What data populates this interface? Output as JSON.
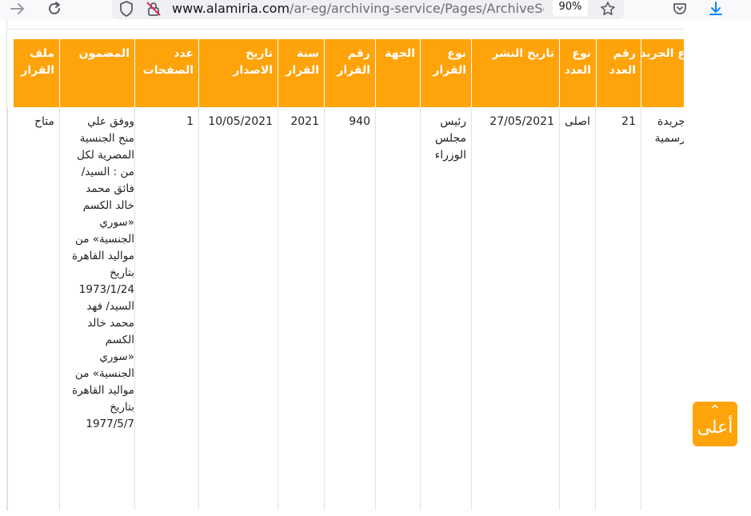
{
  "browser": {
    "url_host": "www.alamiria.com",
    "url_path": "/ar-eg/archiving-service/Pages/ArchiveSear",
    "zoom": "90%"
  },
  "table": {
    "headers": {
      "gazette_type": "نوع الجريدة",
      "issue_number": "رقم العدد",
      "issue_type": "نوع العدد",
      "publish_date": "تاريخ النشر",
      "decision_type": "نوع القرار",
      "authority": "الجهة",
      "decision_number": "رقم القرار",
      "decision_year": "سنة القرار",
      "issue_date": "تاريخ الاصدار",
      "page_count": "عدد الصفحات",
      "content": "المضمون",
      "decision_file": "ملف القرار"
    },
    "row": {
      "gazette_type": "جريدة رسمية",
      "issue_number": "21",
      "issue_type": "اصلى",
      "publish_date": "27/05/2021",
      "decision_type": "رئيس مجلس الوزراء",
      "authority": "",
      "decision_number": "940",
      "decision_year": "2021",
      "issue_date": "10/05/2021",
      "page_count": "1",
      "content": "ووفق علي منح الجنسية المصرية لكل من : السيد/ فائق محمد خالد الكسم «سوري الجنسية» من مواليد القاهرة بتاريخ 1973/1/24 السيد/ فهد محمد خالد الكسم «سوري الجنسية» من مواليد القاهرة بتاريخ 1977/5/7",
      "decision_file": "متاح"
    }
  },
  "back_to_top": "أعلى",
  "colors": {
    "accent": "#ffa30b",
    "grid": "#e2e2e2"
  }
}
